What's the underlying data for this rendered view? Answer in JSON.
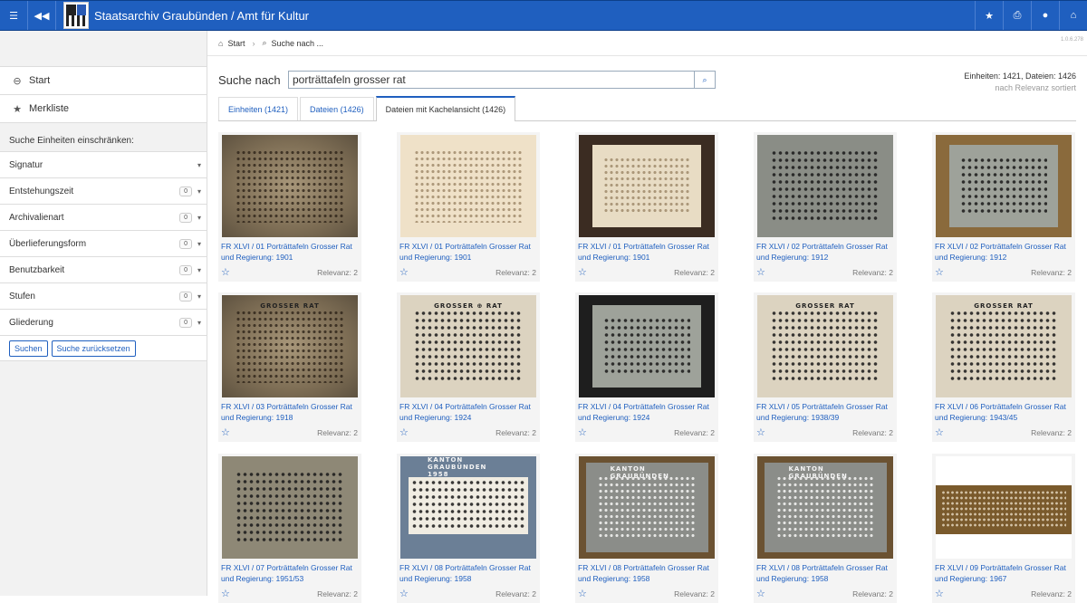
{
  "topbar": {
    "title": "Staatsarchiv Graubünden / Amt für Kultur"
  },
  "sidebar": {
    "nav": [
      {
        "label": "Start",
        "icon": "circle-arrow-left-icon"
      },
      {
        "label": "Merkliste",
        "icon": "star-icon"
      }
    ],
    "filter_heading": "Suche Einheiten einschränken:",
    "filters": [
      {
        "label": "Signatur",
        "count": ""
      },
      {
        "label": "Entstehungszeit",
        "count": "0"
      },
      {
        "label": "Archivalienart",
        "count": "0"
      },
      {
        "label": "Überlieferungsform",
        "count": "0"
      },
      {
        "label": "Benutzbarkeit",
        "count": "0"
      },
      {
        "label": "Stufen",
        "count": "0"
      },
      {
        "label": "Gliederung",
        "count": "0"
      }
    ],
    "search_button": "Suchen",
    "reset_button": "Suche zurücksetzen"
  },
  "breadcrumb": {
    "start": "Start",
    "current": "Suche nach ..."
  },
  "version": "1.0.6.278",
  "search": {
    "label": "Suche nach",
    "value": "porträttafeln grosser rat"
  },
  "counts": {
    "summary": "Einheiten: 1421, Dateien: 1426",
    "sort": "nach Relevanz sortiert"
  },
  "tabs": [
    {
      "label": "Einheiten (1421)",
      "active": false
    },
    {
      "label": "Dateien (1426)",
      "active": false
    },
    {
      "label": "Dateien mit Kachelansicht (1426)",
      "active": true
    }
  ],
  "results": [
    {
      "line1": "FR XLVI / 01 Porträttafeln Grosser Rat",
      "line2": "und Regierung: 1901",
      "relevance": "Relevanz: 2"
    },
    {
      "line1": "FR XLVI / 01 Porträttafeln Grosser Rat",
      "line2": "und Regierung: 1901",
      "relevance": "Relevanz: 2"
    },
    {
      "line1": "FR XLVI / 01 Porträttafeln Grosser Rat",
      "line2": "und Regierung: 1901",
      "relevance": "Relevanz: 2"
    },
    {
      "line1": "FR XLVI / 02 Porträttafeln Grosser Rat",
      "line2": "und Regierung: 1912",
      "relevance": "Relevanz: 2"
    },
    {
      "line1": "FR XLVI / 02 Porträttafeln Grosser Rat",
      "line2": "und Regierung: 1912",
      "relevance": "Relevanz: 2"
    },
    {
      "line1": "FR XLVI / 03 Porträttafeln Grosser Rat",
      "line2": "und Regierung: 1918",
      "relevance": "Relevanz: 2"
    },
    {
      "line1": "FR XLVI / 04 Porträttafeln Grosser Rat",
      "line2": "und Regierung: 1924",
      "relevance": "Relevanz: 2"
    },
    {
      "line1": "FR XLVI / 04 Porträttafeln Grosser Rat",
      "line2": "und Regierung: 1924",
      "relevance": "Relevanz: 2"
    },
    {
      "line1": "FR XLVI / 05 Porträttafeln Grosser Rat",
      "line2": "und Regierung: 1938/39",
      "relevance": "Relevanz: 2"
    },
    {
      "line1": "FR XLVI / 06 Porträttafeln Grosser Rat",
      "line2": "und Regierung: 1943/45",
      "relevance": "Relevanz: 2"
    },
    {
      "line1": "FR XLVI / 07 Porträttafeln Grosser Rat",
      "line2": "und Regierung: 1951/53",
      "relevance": "Relevanz: 2"
    },
    {
      "line1": "FR XLVI / 08 Porträttafeln Grosser Rat",
      "line2": "und Regierung: 1958",
      "relevance": "Relevanz: 2"
    },
    {
      "line1": "FR XLVI / 08 Porträttafeln Grosser Rat",
      "line2": "und Regierung: 1958",
      "relevance": "Relevanz: 2"
    },
    {
      "line1": "FR XLVI / 08 Porträttafeln Grosser Rat",
      "line2": "und Regierung: 1958",
      "relevance": "Relevanz: 2"
    },
    {
      "line1": "FR XLVI / 09 Porträttafeln Grosser Rat",
      "line2": "und Regierung: 1967",
      "relevance": "Relevanz: 2"
    }
  ],
  "photo_text": {
    "grosser_rat": "GROSSER RAT",
    "grosser_rat_spaced": "GROSSER ⊕ RAT",
    "kanton_graubuenden_1958": "KANTON GRAUBÜNDEN 1958",
    "kanton_graubuenden": "KANTON GRAUBÜNDEN"
  }
}
